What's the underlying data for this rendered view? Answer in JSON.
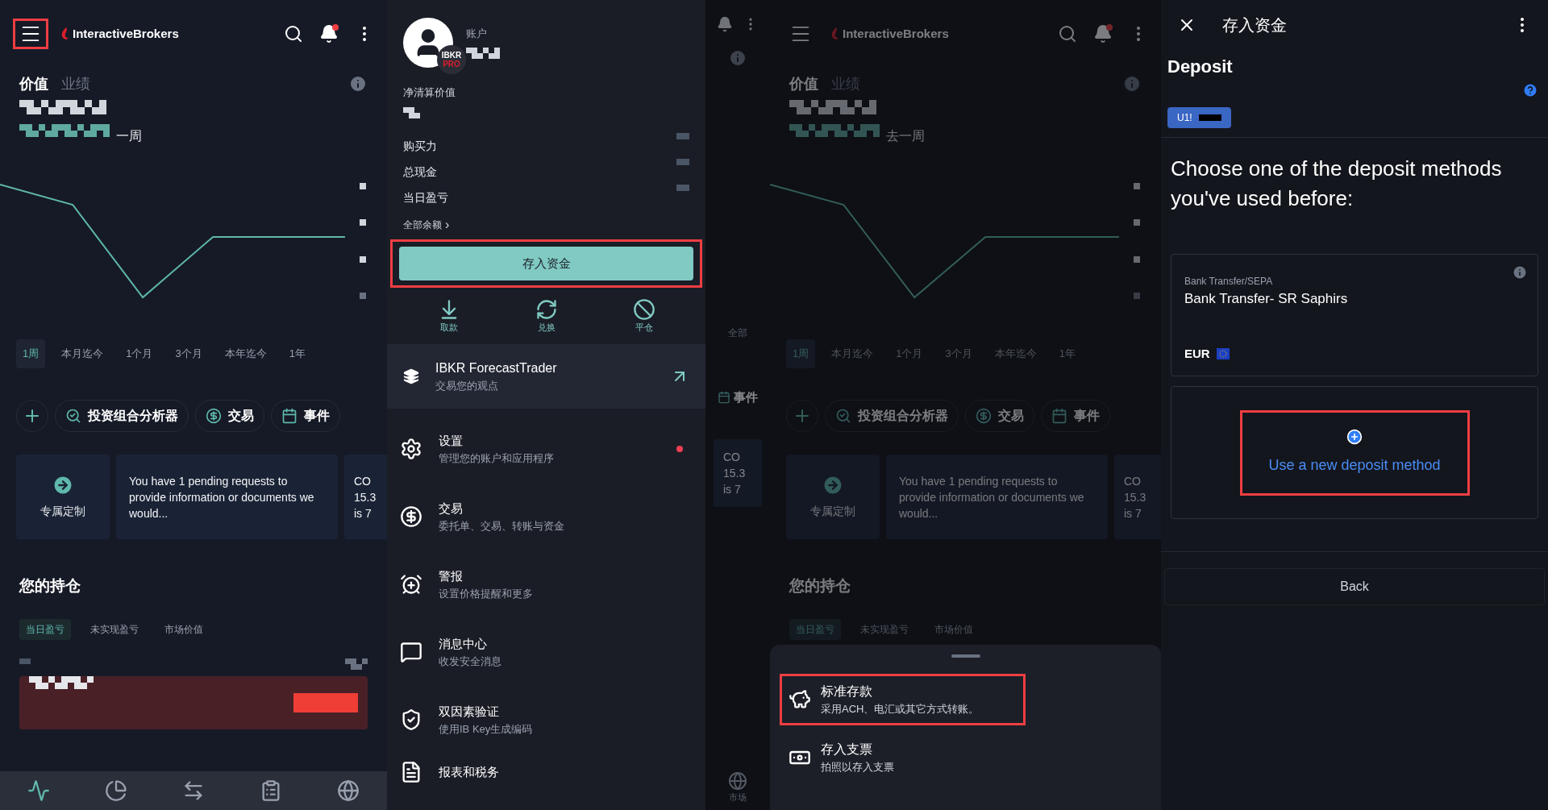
{
  "home": {
    "logo": "InteractiveBrokers",
    "menu_highlighted": true,
    "notification_dot": true,
    "value_tabs": [
      {
        "label": "价值",
        "selected": true
      },
      {
        "label": "业绩",
        "selected": false
      }
    ],
    "period_text": "一周",
    "ranges": [
      {
        "label": "1周",
        "selected": true
      },
      {
        "label": "本月迄今",
        "selected": false
      },
      {
        "label": "1个月",
        "selected": false
      },
      {
        "label": "3个月",
        "selected": false
      },
      {
        "label": "本年迄今",
        "selected": false
      },
      {
        "label": "1年",
        "selected": false
      }
    ],
    "chips": [
      {
        "kind": "add"
      },
      {
        "kind": "analyzer",
        "label": "投资组合分析器"
      },
      {
        "kind": "trade",
        "label": "交易"
      },
      {
        "kind": "events",
        "label": "事件"
      }
    ],
    "cards": [
      {
        "kind": "action",
        "label": "专属定制"
      },
      {
        "kind": "message",
        "text": "You have 1 pending requests to provide information or documents we would..."
      },
      {
        "kind": "cut",
        "lines": [
          "CO",
          "15.3",
          "is 7"
        ]
      }
    ],
    "holdings_title": "您的持仓",
    "holdings_tabs": [
      {
        "label": "当日盈亏",
        "selected": true
      },
      {
        "label": "未实现盈亏",
        "selected": false
      },
      {
        "label": "市场价值",
        "selected": false
      }
    ],
    "nav": [
      {
        "kind": "home",
        "selected": true
      },
      {
        "kind": "portfolio",
        "selected": false
      },
      {
        "kind": "trade",
        "selected": false
      },
      {
        "kind": "watchlist",
        "selected": false
      },
      {
        "kind": "markets",
        "selected": false
      }
    ]
  },
  "drawer": {
    "account_label": "账户",
    "badge_top": "IBKR",
    "badge_bottom": "PRO",
    "net_liq_label": "净清算价值",
    "balances": [
      "购买力",
      "总现金",
      "当日盈亏"
    ],
    "all_balances": "全部余额",
    "all_balances_arrow": "›",
    "deposit": {
      "label": "存入资金",
      "highlighted": true
    },
    "actions": [
      {
        "kind": "withdraw",
        "label": "取款"
      },
      {
        "kind": "convert",
        "label": "兑换"
      },
      {
        "kind": "close",
        "label": "平仓"
      }
    ],
    "featured": {
      "title": "IBKR ForecastTrader",
      "subtitle": "交易您的观点"
    },
    "menu": [
      {
        "kind": "settings",
        "title": "设置",
        "subtitle": "管理您的账户和应用程序",
        "alert": true
      },
      {
        "kind": "trade",
        "title": "交易",
        "subtitle": "委托单、交易、转账与资金",
        "alert": false
      },
      {
        "kind": "alerts",
        "title": "警报",
        "subtitle": "设置价格提醒和更多",
        "alert": false
      },
      {
        "kind": "messages",
        "title": "消息中心",
        "subtitle": "收发安全消息",
        "alert": false
      },
      {
        "kind": "twofactor",
        "title": "双因素验证",
        "subtitle": "使用IB Key生成编码",
        "alert": false
      },
      {
        "kind": "reports",
        "title": "报表和税务",
        "alert": false
      }
    ]
  },
  "transition": {
    "strip": {
      "range_label": "全部",
      "chip_label": "事件",
      "card_lines": [
        "CO",
        "15.3",
        "is 7"
      ],
      "nav_label": "市场"
    },
    "home": {
      "logo": "InteractiveBrokers",
      "menu_highlighted": false,
      "notification_dot": true,
      "value_tabs": [
        {
          "label": "价值",
          "selected": true
        },
        {
          "label": "业绩",
          "selected": false
        }
      ],
      "period_text": "去一周",
      "ranges": [
        {
          "label": "1周",
          "selected": true
        },
        {
          "label": "本月迄今",
          "selected": false
        },
        {
          "label": "1个月",
          "selected": false
        },
        {
          "label": "3个月",
          "selected": false
        },
        {
          "label": "本年迄今",
          "selected": false
        },
        {
          "label": "1年",
          "selected": false
        }
      ],
      "chips": [
        {
          "kind": "add"
        },
        {
          "kind": "analyzer",
          "label": "投资组合分析器"
        },
        {
          "kind": "trade",
          "label": "交易"
        },
        {
          "kind": "events",
          "label": "事件"
        }
      ],
      "cards": [
        {
          "kind": "action",
          "label": "专属定制"
        },
        {
          "kind": "message",
          "text": "You have 1 pending requests to provide information or documents we would..."
        },
        {
          "kind": "cut",
          "lines": [
            "CO",
            "15.3",
            "is 7"
          ]
        }
      ],
      "holdings_title": "您的持仓",
      "holdings_tabs": [
        {
          "label": "当日盈亏",
          "selected": true
        },
        {
          "label": "未实现盈亏",
          "selected": false
        },
        {
          "label": "市场价值",
          "selected": false
        }
      ]
    },
    "sheet": [
      {
        "kind": "standard",
        "title": "标准存款",
        "subtitle": "采用ACH、电汇或其它方式转账。",
        "highlighted": true
      },
      {
        "kind": "check",
        "title": "存入支票",
        "subtitle": "拍照以存入支票",
        "highlighted": false
      }
    ]
  },
  "deposit": {
    "header_title": "存入资金",
    "title": "Deposit",
    "account": "U1!",
    "prompt": "Choose one of the deposit methods you've used before:",
    "methods": [
      {
        "type": "Bank Transfer/SEPA",
        "name": "Bank Transfer- SR Saphirs",
        "currency": "EUR"
      }
    ],
    "new_method": {
      "label": "Use a new deposit method",
      "highlighted": true
    },
    "back": "Back"
  }
}
